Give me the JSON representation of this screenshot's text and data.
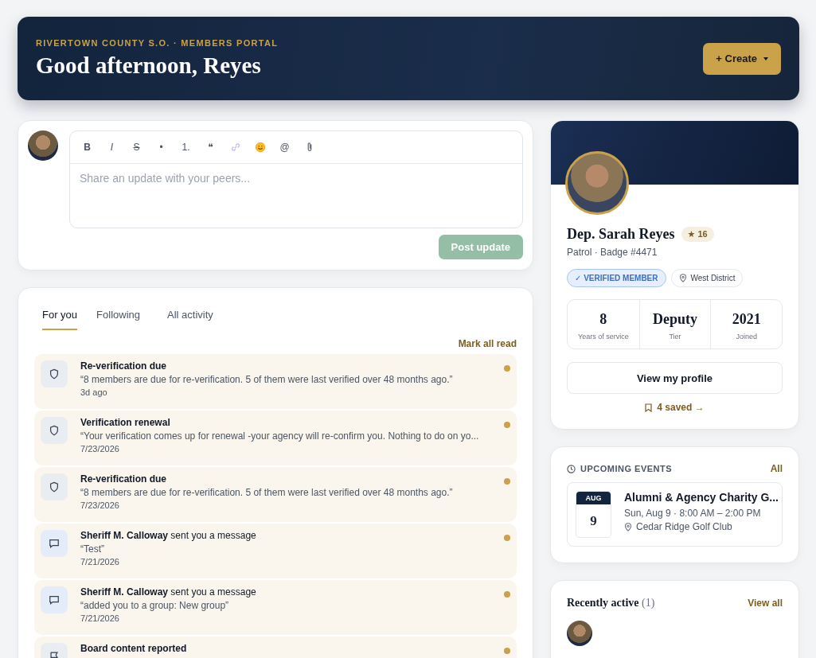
{
  "header": {
    "eyebrow": "RIVERTOWN COUNTY S.O. · MEMBERS PORTAL",
    "greeting": "Good afternoon, Reyes",
    "create_button": "+ Create"
  },
  "composer": {
    "toolbar": [
      {
        "kind": "bold",
        "label": "B"
      },
      {
        "kind": "italic",
        "label": "I"
      },
      {
        "kind": "strike",
        "label": "S"
      },
      {
        "kind": "text",
        "label": "•"
      },
      {
        "kind": "text",
        "label": "1."
      },
      {
        "kind": "text",
        "label": "❝"
      },
      {
        "kind": "link"
      },
      {
        "kind": "emoji"
      },
      {
        "kind": "text",
        "label": "@"
      },
      {
        "kind": "attach"
      }
    ],
    "placeholder": "Share an update with your peers...",
    "post_button": "Post update",
    "post_disabled": true
  },
  "feed": {
    "tabs": [
      {
        "label": "For you",
        "selected": true
      },
      {
        "label": "Following",
        "selected": false
      },
      {
        "label": "All activity",
        "selected": false
      }
    ],
    "mark_all_read": "Mark all read",
    "notifications": [
      {
        "kind": "shield",
        "title": "Re-verification due",
        "body": "“8 members are due for re-verification. 5 of them were last verified over 48 months ago.”",
        "time": "3d ago",
        "unread": true
      },
      {
        "kind": "shield",
        "title": "Verification renewal",
        "body": "“Your verification comes up for renewal -your agency will re-confirm you. Nothing to do on yo...",
        "time": "7/23/2026",
        "unread": true
      },
      {
        "kind": "shield",
        "title": "Re-verification due",
        "body": "“8 members are due for re-verification. 5 of them were last verified over 48 months ago.”",
        "time": "7/23/2026",
        "unread": true
      },
      {
        "kind": "message",
        "title": "**Sheriff M. Calloway** sent you a message",
        "body": "“Test”",
        "time": "7/21/2026",
        "unread": true
      },
      {
        "kind": "message",
        "title": "**Sheriff M. Calloway** sent you a message",
        "body": "“added you to a group: New group”",
        "time": "7/21/2026",
        "unread": true
      },
      {
        "kind": "flag",
        "title": "Board content reported",
        "unread": true
      }
    ]
  },
  "profile": {
    "name": "Dep. Sarah Reyes",
    "stars": "★ 16",
    "subtitle": "Patrol · Badge #4471",
    "verified": "✓ VERIFIED MEMBER",
    "district": "West District",
    "stats": [
      {
        "value": "8",
        "label": "Years of service"
      },
      {
        "value": "Deputy",
        "label": "Tier"
      },
      {
        "value": "2021",
        "label": "Joined"
      }
    ],
    "view_button": "View my profile",
    "saved": "4 saved →"
  },
  "events": {
    "title": "UPCOMING EVENTS",
    "all_link": "All",
    "items": [
      {
        "month": "AUG",
        "day": "9",
        "name": "Alumni & Agency Charity G...",
        "when": "Sun, Aug 9 · 8:00 AM – 2:00 PM",
        "place": "Cedar Ridge Golf Club"
      }
    ]
  },
  "recent": {
    "title": "Recently active",
    "count": "(1)",
    "view_all": "View all"
  }
}
